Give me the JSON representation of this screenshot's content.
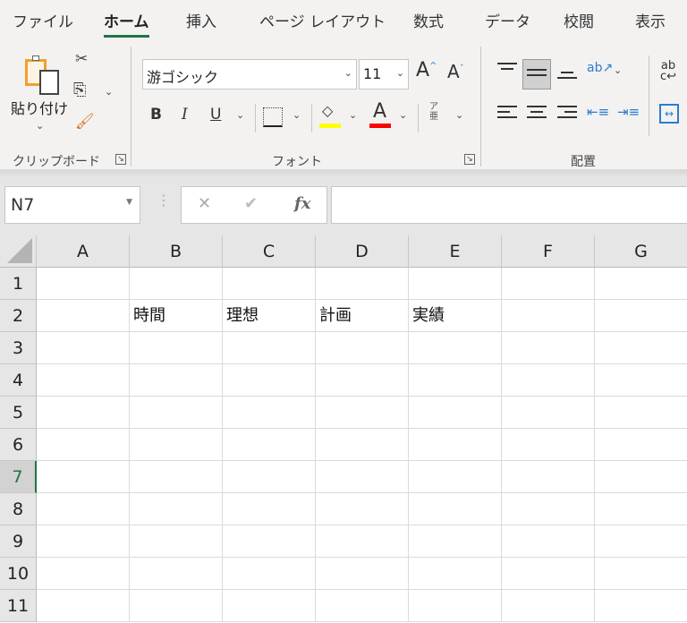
{
  "tabs": [
    "ファイル",
    "ホーム",
    "挿入",
    "ページ レイアウト",
    "数式",
    "データ",
    "校閲",
    "表示"
  ],
  "active_tab": "ホーム",
  "clipboard": {
    "paste_label": "貼り付け",
    "group_label": "クリップボード"
  },
  "font": {
    "name": "游ゴシック",
    "size": "11",
    "group_label": "フォント",
    "fill_color": "#ffff00",
    "font_color": "#ff0000",
    "phonetic_label": "ア\n亜"
  },
  "alignment": {
    "group_label": "配置"
  },
  "formula_bar": {
    "name_box": "N7",
    "cancel": "✕",
    "enter": "✔",
    "fx": "fx",
    "formula": ""
  },
  "columns": [
    "A",
    "B",
    "C",
    "D",
    "E",
    "F",
    "G"
  ],
  "rows": [
    "1",
    "2",
    "3",
    "4",
    "5",
    "6",
    "7",
    "8",
    "9",
    "10",
    "11"
  ],
  "selected_row": "7",
  "cells": {
    "B2": "時間",
    "C2": "理想",
    "D2": "計画",
    "E2": "実績"
  },
  "accent": "#217346"
}
